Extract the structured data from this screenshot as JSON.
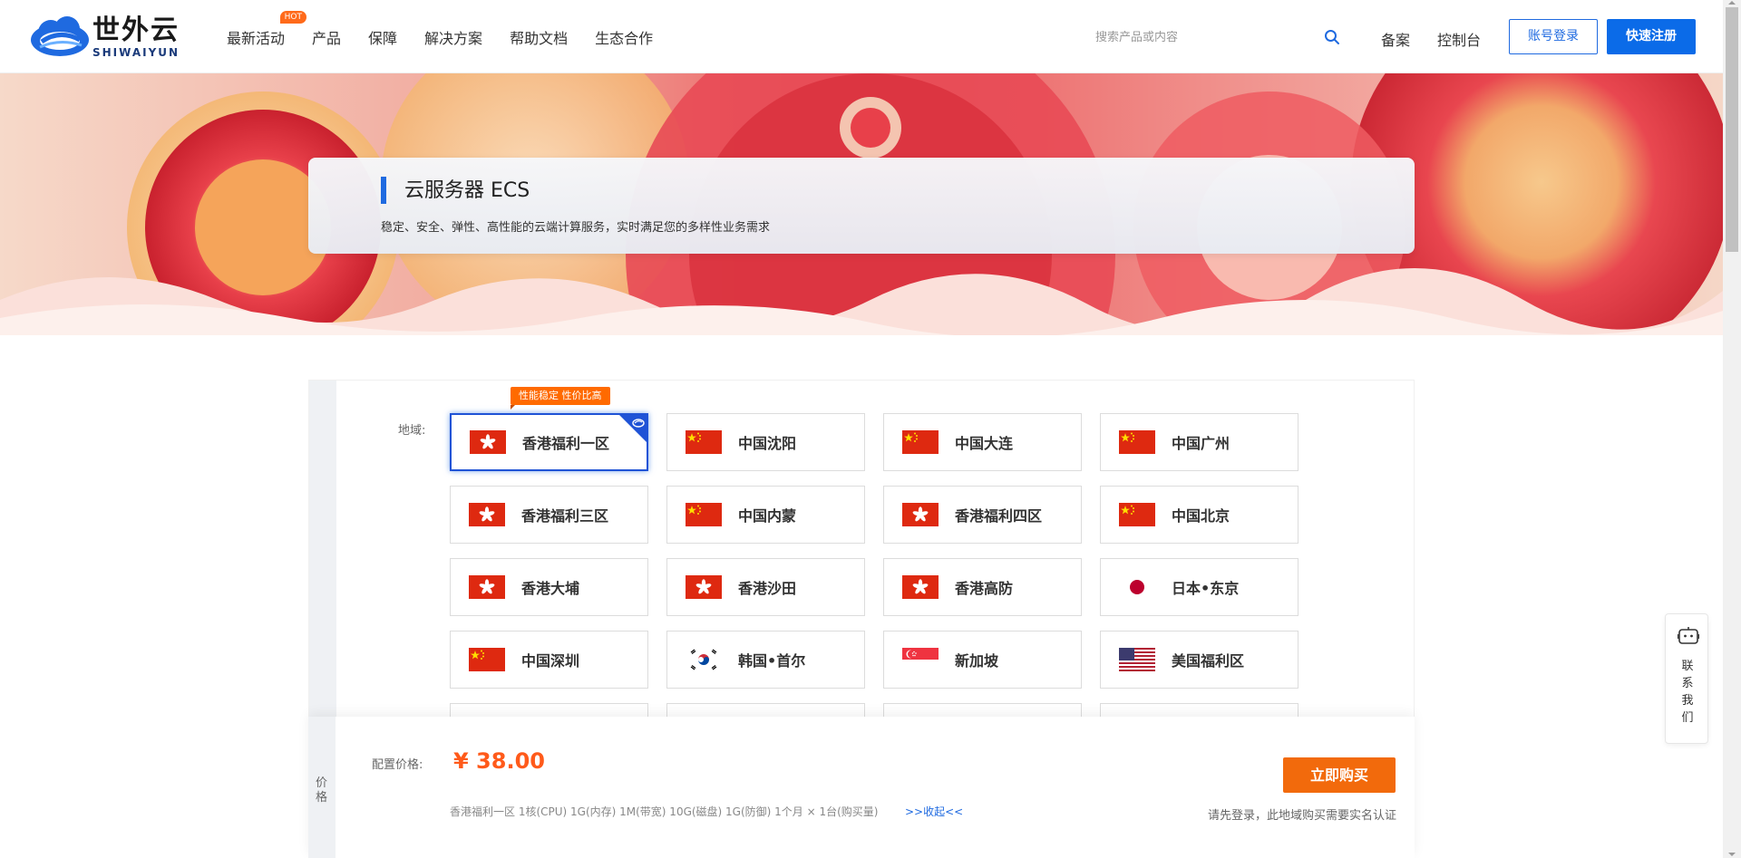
{
  "header": {
    "logo": {
      "cn": "世外云",
      "en": "SHIWAIYUN"
    },
    "nav": [
      {
        "label": "最新活动",
        "badge": "HOT"
      },
      {
        "label": "产品"
      },
      {
        "label": "保障"
      },
      {
        "label": "解决方案"
      },
      {
        "label": "帮助文档"
      },
      {
        "label": "生态合作"
      }
    ],
    "search": {
      "placeholder": "搜索产品或内容",
      "value": ""
    },
    "links": {
      "beian": "备案",
      "console": "控制台"
    },
    "login_label": "账号登录",
    "register_label": "快速注册"
  },
  "hero": {
    "title": "云服务器 ECS",
    "description": "稳定、安全、弹性、高性能的云端计算服务，实时满足您的多样性业务需求"
  },
  "region": {
    "label": "地域:",
    "promo_tag": "性能稳定 性价比高",
    "items": [
      {
        "name": "香港福利一区",
        "flag": "hk",
        "selected": true
      },
      {
        "name": "中国沈阳",
        "flag": "cn"
      },
      {
        "name": "中国大连",
        "flag": "cn"
      },
      {
        "name": "中国广州",
        "flag": "cn"
      },
      {
        "name": "香港福利三区",
        "flag": "hk"
      },
      {
        "name": "中国内蒙",
        "flag": "cn"
      },
      {
        "name": "香港福利四区",
        "flag": "hk"
      },
      {
        "name": "中国北京",
        "flag": "cn"
      },
      {
        "name": "香港大埔",
        "flag": "hk"
      },
      {
        "name": "香港沙田",
        "flag": "hk"
      },
      {
        "name": "香港高防",
        "flag": "hk"
      },
      {
        "name": "日本•东京",
        "flag": "jp"
      },
      {
        "name": "中国深圳",
        "flag": "cn"
      },
      {
        "name": "韩国•首尔",
        "flag": "kr"
      },
      {
        "name": "新加坡",
        "flag": "sg"
      },
      {
        "name": "美国福利区",
        "flag": "us"
      }
    ]
  },
  "price": {
    "side_label": "价格",
    "label": "配置价格:",
    "value": "¥ 38.00",
    "summary": "香港福利一区  1核(CPU)  1G(内存)  1M(带宽)  10G(磁盘)  1G(防御)  1个月 × 1台(购买量)",
    "collapse_label": ">>收起<<",
    "buy_label": "立即购买",
    "login_note": "请先登录，此地域购买需要实名认证"
  },
  "contact": {
    "label": "联系我们"
  },
  "colors": {
    "primary": "#1f6ae0",
    "accent_orange": "#ff5a1a",
    "buy_button": "#f26a0c",
    "selected_border": "#1f53d6"
  }
}
